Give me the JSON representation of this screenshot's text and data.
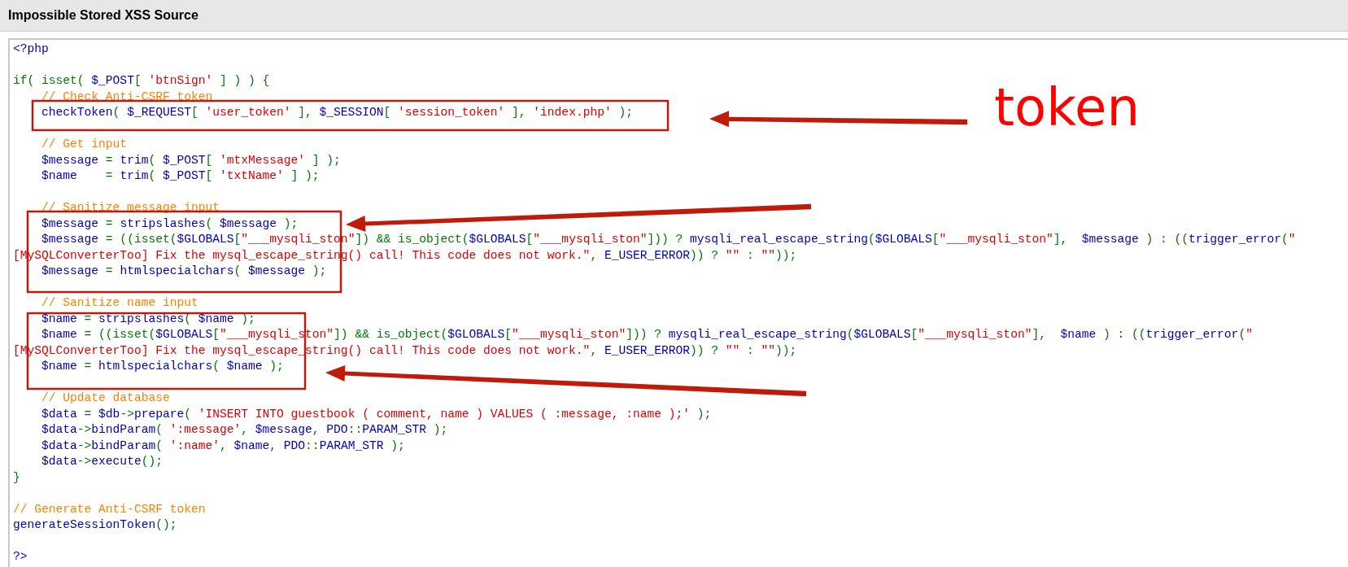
{
  "title": "Impossible Stored XSS Source",
  "code": [
    {
      "segments": [
        {
          "kind": "name",
          "text": "<?php"
        }
      ]
    },
    {
      "space_before": true,
      "segments": [
        {
          "kind": "keyword",
          "text": "if( isset( "
        },
        {
          "kind": "name",
          "text": "$_POST"
        },
        {
          "kind": "keyword",
          "text": "[ "
        },
        {
          "kind": "string",
          "text": "'btnSign'"
        },
        {
          "kind": "keyword",
          "text": " ] ) ) {"
        }
      ]
    },
    {
      "segments": [
        {
          "kind": "comment",
          "text": "    // Check Anti-CSRF token"
        }
      ]
    },
    {
      "segments": [
        {
          "kind": "name",
          "text": "    checkToken"
        },
        {
          "kind": "keyword",
          "text": "( "
        },
        {
          "kind": "name",
          "text": "$_REQUEST"
        },
        {
          "kind": "keyword",
          "text": "[ "
        },
        {
          "kind": "string",
          "text": "'user_token'"
        },
        {
          "kind": "keyword",
          "text": " ], "
        },
        {
          "kind": "name",
          "text": "$_SESSION"
        },
        {
          "kind": "keyword",
          "text": "[ "
        },
        {
          "kind": "string",
          "text": "'session_token'"
        },
        {
          "kind": "keyword",
          "text": " ], "
        },
        {
          "kind": "string",
          "text": "'index.php'"
        },
        {
          "kind": "keyword",
          "text": " );"
        }
      ]
    },
    {
      "space_before": true,
      "segments": [
        {
          "kind": "comment",
          "text": "    // Get input"
        }
      ]
    },
    {
      "segments": [
        {
          "kind": "name",
          "text": "    $message "
        },
        {
          "kind": "keyword",
          "text": "= "
        },
        {
          "kind": "name",
          "text": "trim"
        },
        {
          "kind": "keyword",
          "text": "( "
        },
        {
          "kind": "name",
          "text": "$_POST"
        },
        {
          "kind": "keyword",
          "text": "[ "
        },
        {
          "kind": "string",
          "text": "'mtxMessage'"
        },
        {
          "kind": "keyword",
          "text": " ] );"
        }
      ]
    },
    {
      "segments": [
        {
          "kind": "name",
          "text": "    $name    "
        },
        {
          "kind": "keyword",
          "text": "= "
        },
        {
          "kind": "name",
          "text": "trim"
        },
        {
          "kind": "keyword",
          "text": "( "
        },
        {
          "kind": "name",
          "text": "$_POST"
        },
        {
          "kind": "keyword",
          "text": "[ "
        },
        {
          "kind": "string",
          "text": "'txtName'"
        },
        {
          "kind": "keyword",
          "text": " ] );"
        }
      ]
    },
    {
      "space_before": true,
      "segments": [
        {
          "kind": "comment",
          "text": "    // Sanitize message input"
        }
      ]
    },
    {
      "segments": [
        {
          "kind": "name",
          "text": "    $message "
        },
        {
          "kind": "keyword",
          "text": "= "
        },
        {
          "kind": "name",
          "text": "stripslashes"
        },
        {
          "kind": "keyword",
          "text": "( "
        },
        {
          "kind": "name",
          "text": "$message "
        },
        {
          "kind": "keyword",
          "text": ");"
        }
      ]
    },
    {
      "segments": [
        {
          "kind": "name",
          "text": "    $message "
        },
        {
          "kind": "keyword",
          "text": "= ((isset("
        },
        {
          "kind": "name",
          "text": "$GLOBALS"
        },
        {
          "kind": "keyword",
          "text": "["
        },
        {
          "kind": "string",
          "text": "\"___mysqli_ston\""
        },
        {
          "kind": "keyword",
          "text": "]) && is_object("
        },
        {
          "kind": "name",
          "text": "$GLOBALS"
        },
        {
          "kind": "keyword",
          "text": "["
        },
        {
          "kind": "string",
          "text": "\"___mysqli_ston\""
        },
        {
          "kind": "keyword",
          "text": "])) ? "
        },
        {
          "kind": "name",
          "text": "mysqli_real_escape_string"
        },
        {
          "kind": "keyword",
          "text": "("
        },
        {
          "kind": "name",
          "text": "$GLOBALS"
        },
        {
          "kind": "keyword",
          "text": "["
        },
        {
          "kind": "string",
          "text": "\"___mysqli_ston\""
        },
        {
          "kind": "keyword",
          "text": "],  "
        },
        {
          "kind": "name",
          "text": "$message "
        },
        {
          "kind": "keyword",
          "text": ") : (("
        },
        {
          "kind": "name",
          "text": "trigger_error"
        },
        {
          "kind": "keyword",
          "text": "("
        },
        {
          "kind": "string",
          "text": "\""
        }
      ]
    },
    {
      "segments": [
        {
          "kind": "string",
          "text": "[MySQLConverterToo] Fix the mysql_escape_string() call! This code does not work.\""
        },
        {
          "kind": "keyword",
          "text": ", "
        },
        {
          "kind": "name",
          "text": "E_USER_ERROR"
        },
        {
          "kind": "keyword",
          "text": ")) ? "
        },
        {
          "kind": "string",
          "text": "\"\""
        },
        {
          "kind": "keyword",
          "text": " : "
        },
        {
          "kind": "string",
          "text": "\"\""
        },
        {
          "kind": "keyword",
          "text": "));"
        }
      ]
    },
    {
      "segments": [
        {
          "kind": "name",
          "text": "    $message "
        },
        {
          "kind": "keyword",
          "text": "= "
        },
        {
          "kind": "name",
          "text": "htmlspecialchars"
        },
        {
          "kind": "keyword",
          "text": "( "
        },
        {
          "kind": "name",
          "text": "$message "
        },
        {
          "kind": "keyword",
          "text": ");"
        }
      ]
    },
    {
      "space_before": true,
      "segments": [
        {
          "kind": "comment",
          "text": "    // Sanitize name input"
        }
      ]
    },
    {
      "segments": [
        {
          "kind": "name",
          "text": "    $name "
        },
        {
          "kind": "keyword",
          "text": "= "
        },
        {
          "kind": "name",
          "text": "stripslashes"
        },
        {
          "kind": "keyword",
          "text": "( "
        },
        {
          "kind": "name",
          "text": "$name "
        },
        {
          "kind": "keyword",
          "text": ");"
        }
      ]
    },
    {
      "segments": [
        {
          "kind": "name",
          "text": "    $name "
        },
        {
          "kind": "keyword",
          "text": "= ((isset("
        },
        {
          "kind": "name",
          "text": "$GLOBALS"
        },
        {
          "kind": "keyword",
          "text": "["
        },
        {
          "kind": "string",
          "text": "\"___mysqli_ston\""
        },
        {
          "kind": "keyword",
          "text": "]) && is_object("
        },
        {
          "kind": "name",
          "text": "$GLOBALS"
        },
        {
          "kind": "keyword",
          "text": "["
        },
        {
          "kind": "string",
          "text": "\"___mysqli_ston\""
        },
        {
          "kind": "keyword",
          "text": "])) ? "
        },
        {
          "kind": "name",
          "text": "mysqli_real_escape_string"
        },
        {
          "kind": "keyword",
          "text": "("
        },
        {
          "kind": "name",
          "text": "$GLOBALS"
        },
        {
          "kind": "keyword",
          "text": "["
        },
        {
          "kind": "string",
          "text": "\"___mysqli_ston\""
        },
        {
          "kind": "keyword",
          "text": "],  "
        },
        {
          "kind": "name",
          "text": "$name "
        },
        {
          "kind": "keyword",
          "text": ") : (("
        },
        {
          "kind": "name",
          "text": "trigger_error"
        },
        {
          "kind": "keyword",
          "text": "("
        },
        {
          "kind": "string",
          "text": "\""
        }
      ]
    },
    {
      "segments": [
        {
          "kind": "string",
          "text": "[MySQLConverterToo] Fix the mysql_escape_string() call! This code does not work.\""
        },
        {
          "kind": "keyword",
          "text": ", "
        },
        {
          "kind": "name",
          "text": "E_USER_ERROR"
        },
        {
          "kind": "keyword",
          "text": ")) ? "
        },
        {
          "kind": "string",
          "text": "\"\""
        },
        {
          "kind": "keyword",
          "text": " : "
        },
        {
          "kind": "string",
          "text": "\"\""
        },
        {
          "kind": "keyword",
          "text": "));"
        }
      ]
    },
    {
      "segments": [
        {
          "kind": "name",
          "text": "    $name "
        },
        {
          "kind": "keyword",
          "text": "= "
        },
        {
          "kind": "name",
          "text": "htmlspecialchars"
        },
        {
          "kind": "keyword",
          "text": "( "
        },
        {
          "kind": "name",
          "text": "$name "
        },
        {
          "kind": "keyword",
          "text": ");"
        }
      ]
    },
    {
      "space_before": true,
      "segments": [
        {
          "kind": "comment",
          "text": "    // Update database"
        }
      ]
    },
    {
      "segments": [
        {
          "kind": "name",
          "text": "    $data "
        },
        {
          "kind": "keyword",
          "text": "= "
        },
        {
          "kind": "name",
          "text": "$db"
        },
        {
          "kind": "keyword",
          "text": "->"
        },
        {
          "kind": "name",
          "text": "prepare"
        },
        {
          "kind": "keyword",
          "text": "( "
        },
        {
          "kind": "string",
          "text": "'INSERT INTO guestbook ( comment, name ) VALUES ( :message, :name );'"
        },
        {
          "kind": "keyword",
          "text": " );"
        }
      ]
    },
    {
      "segments": [
        {
          "kind": "name",
          "text": "    $data"
        },
        {
          "kind": "keyword",
          "text": "->"
        },
        {
          "kind": "name",
          "text": "bindParam"
        },
        {
          "kind": "keyword",
          "text": "( "
        },
        {
          "kind": "string",
          "text": "':message'"
        },
        {
          "kind": "keyword",
          "text": ", "
        },
        {
          "kind": "name",
          "text": "$message"
        },
        {
          "kind": "keyword",
          "text": ", "
        },
        {
          "kind": "name",
          "text": "PDO"
        },
        {
          "kind": "keyword",
          "text": "::"
        },
        {
          "kind": "name",
          "text": "PARAM_STR "
        },
        {
          "kind": "keyword",
          "text": ");"
        }
      ]
    },
    {
      "segments": [
        {
          "kind": "name",
          "text": "    $data"
        },
        {
          "kind": "keyword",
          "text": "->"
        },
        {
          "kind": "name",
          "text": "bindParam"
        },
        {
          "kind": "keyword",
          "text": "( "
        },
        {
          "kind": "string",
          "text": "':name'"
        },
        {
          "kind": "keyword",
          "text": ", "
        },
        {
          "kind": "name",
          "text": "$name"
        },
        {
          "kind": "keyword",
          "text": ", "
        },
        {
          "kind": "name",
          "text": "PDO"
        },
        {
          "kind": "keyword",
          "text": "::"
        },
        {
          "kind": "name",
          "text": "PARAM_STR "
        },
        {
          "kind": "keyword",
          "text": ");"
        }
      ]
    },
    {
      "segments": [
        {
          "kind": "name",
          "text": "    $data"
        },
        {
          "kind": "keyword",
          "text": "->"
        },
        {
          "kind": "name",
          "text": "execute"
        },
        {
          "kind": "keyword",
          "text": "();"
        }
      ]
    },
    {
      "segments": [
        {
          "kind": "keyword",
          "text": "}"
        }
      ]
    },
    {
      "space_before": true,
      "segments": [
        {
          "kind": "comment",
          "text": "// Generate Anti-CSRF token"
        }
      ]
    },
    {
      "segments": [
        {
          "kind": "name",
          "text": "generateSessionToken"
        },
        {
          "kind": "keyword",
          "text": "();"
        }
      ]
    },
    {
      "space_before": true,
      "segments": [
        {
          "kind": "name",
          "text": "?>"
        }
      ]
    }
  ],
  "annotation": {
    "label": "token"
  }
}
